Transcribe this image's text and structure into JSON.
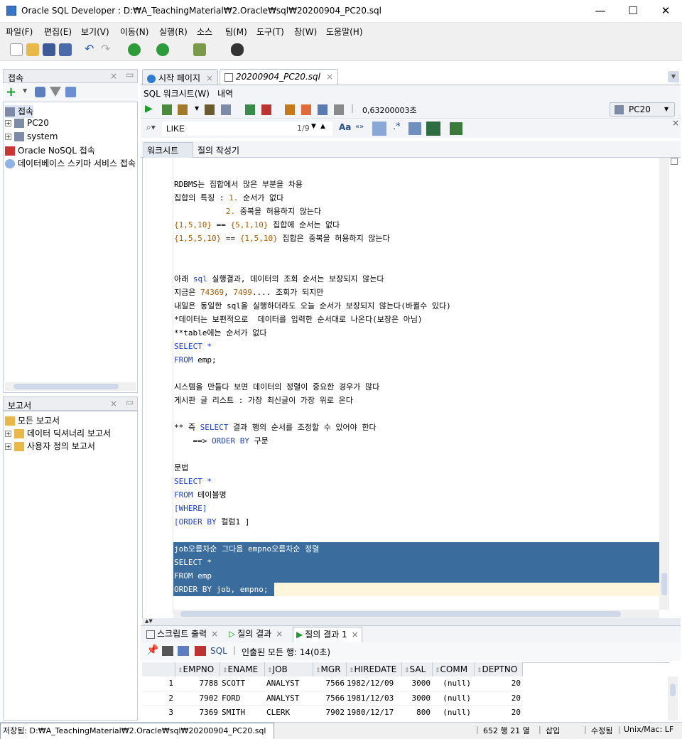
{
  "window": {
    "title": "Oracle SQL Developer : D:₩A_TeachingMaterial₩2.Oracle₩sql₩20200904_PC20.sql",
    "minimize": "—",
    "maximize": "☐",
    "close": "✕"
  },
  "menu": [
    "파일(F)",
    "편집(E)",
    "보기(V)",
    "이동(N)",
    "실행(R)",
    "소스",
    "팀(M)",
    "도구(T)",
    "창(W)",
    "도움말(H)"
  ],
  "connections": {
    "title": "접속",
    "root": "접속",
    "items": [
      "PC20",
      "system"
    ],
    "nosql": "Oracle NoSQL 접속",
    "cloud": "데이터베이스 스키마 서비스 접속"
  },
  "reports": {
    "title": "보고서",
    "items": [
      "모든 보고서",
      "데이터 딕셔너리 보고서",
      "사용자 정의 보고서"
    ]
  },
  "tabs": {
    "start": "시작 페이지",
    "file": "20200904_PC20.sql"
  },
  "worksheet": {
    "tab_sql": "SQL 워크시트(W)",
    "tab_history": "내역",
    "timing": "0,63200003초",
    "connection": "PC20",
    "search_value": "LIKE",
    "search_count": "1/9",
    "sub_tab_ws": "워크시트",
    "sub_tab_qb": "질의 작성기",
    "match_case": "Aa",
    "whole": "«»"
  },
  "code": {
    "l1": "RDBMS는 집합에서 많은 부분을 차용",
    "l2a": "집합의 특징 : ",
    "l2b": "1.",
    "l2c": " 순서가 없다",
    "l3a": "           ",
    "l3b": "2.",
    "l3c": " 중복을 허용하지 않는다",
    "l4a": "{1,5,10}",
    "l4b": " == ",
    "l4c": "{5,1,10}",
    "l4d": " 집합에 순서는 없다",
    "l5a": "{1,5,5,10}",
    "l5b": " == ",
    "l5c": "{1,5,10}",
    "l5d": " 집합은 중복을 허용하지 않는다",
    "l6a": "아래 ",
    "l6b": "sql",
    "l6c": " 실행결과, 데이터의 조회 순서는 보장되지 않는다",
    "l7a": "지금은 ",
    "l7b": "74369",
    "l7c": ", ",
    "l7d": "7499",
    "l7e": ".... 조회가 되지만",
    "l8": "내일은 동일한 sql을 실행하더라도 오늘 순서가 보장되지 않는다(바뀔수 있다)",
    "l9": "*데이터는 보편적으로  데이터를 입력한 순서대로 나온다(보장은 아님)",
    "l10": "**table에는 순서가 없다",
    "l11": "SELECT *",
    "l12a": "FROM",
    "l12b": " emp;",
    "l13": "시스템을 만들다 보면 데이터의 정렬이 중요한 경우가 많다",
    "l14": "게시판 글 리스트 : 가장 최신글이 가장 위로 온다",
    "l15a": "** 즉 ",
    "l15b": "SELECT",
    "l15c": " 결과 행의 순서를 조정할 수 있어야 한다",
    "l16a": "    ==> ",
    "l16b": "ORDER BY",
    "l16c": " 구문",
    "l17": "문법",
    "l18": "SELECT *",
    "l19a": "FROM",
    "l19b": " 테이블명",
    "l20": "[WHERE]",
    "l21a": "[ORDER BY",
    "l21b": " 컬럼1 ]",
    "s1": "job오름차순 그다음 empno오름차순 정렬",
    "s2": "SELECT *",
    "s3": "FROM emp",
    "s4": "ORDER BY job, empno;"
  },
  "results": {
    "tab1": "스크립트 출력",
    "tab2": "질의 결과",
    "tab3": "질의 결과 1",
    "sql": "SQL",
    "fetched": "인출된 모든 행: 14(0초)",
    "columns": [
      "EMPNO",
      "ENAME",
      "JOB",
      "MGR",
      "HIREDATE",
      "SAL",
      "COMM",
      "DEPTNO"
    ],
    "rows": [
      {
        "n": "1",
        "empno": "7788",
        "ename": "SCOTT",
        "job": "ANALYST",
        "mgr": "7566",
        "hiredate": "1982/12/09",
        "sal": "3000",
        "comm": "(null)",
        "deptno": "20"
      },
      {
        "n": "2",
        "empno": "7902",
        "ename": "FORD",
        "job": "ANALYST",
        "mgr": "7566",
        "hiredate": "1981/12/03",
        "sal": "3000",
        "comm": "(null)",
        "deptno": "20"
      },
      {
        "n": "3",
        "empno": "7369",
        "ename": "SMITH",
        "job": "CLERK",
        "mgr": "7902",
        "hiredate": "1980/12/17",
        "sal": "800",
        "comm": "(null)",
        "deptno": "20"
      }
    ]
  },
  "status": {
    "saved": "저장됨: D:₩A_TeachingMaterial₩2.Oracle₩sql₩20200904_PC20.sql",
    "position": "652 행 21 열",
    "insert": "삽입",
    "modified": "수정됨",
    "eol": "Unix/Mac: LF"
  }
}
